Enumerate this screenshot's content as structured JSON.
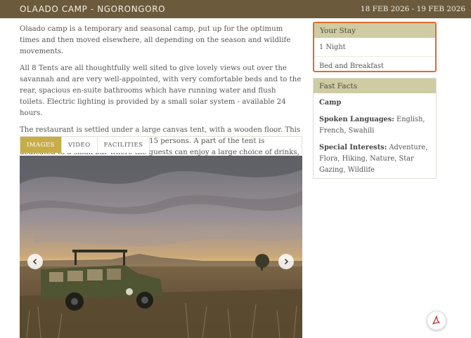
{
  "header": {
    "title": "OLAADO CAMP - NGORONGORO",
    "dates": "18 FEB 2026 - 19 FEB 2026"
  },
  "description": {
    "paragraphs": [
      "Olaado camp is a temporary and seasonal camp, put up for the optimum times and then moved elsewhere, all depending on the season and wildlife movements.",
      "All 8 Tents are all thoughtfully well sited to give lovely views out over the savannah and are very well-appointed, with very comfortable beds and to the rear, spacious en-suite bathrooms which have running water and flush toilets. Electric lighting is provided by a small solar system - available 24 hours.",
      "The restaurant is settled under a large canvas tent, with a wooden floor. This restaurant can accommodate up to 15 persons. A part of the tent is dedicated to a small bar where the guests can enjoy a large choice of drinks, before or after dinner."
    ]
  },
  "media_tabs": {
    "items": [
      "IMAGES",
      "VIDEO",
      "FACILITIES"
    ],
    "active_index": 0
  },
  "gallery": {
    "prev_icon": "chevron-left-icon",
    "next_icon": "chevron-right-icon"
  },
  "your_stay": {
    "heading": "Your Stay",
    "nights": "1 Night",
    "board": "Bed and Breakfast"
  },
  "fast_facts": {
    "heading": "Fast Facts",
    "type": "Camp",
    "languages_label": "Spoken Languages:",
    "languages_value": "English, French, Swahili",
    "interests_label": "Special Interests:",
    "interests_value": "Adventure, Flora, Hiking, Nature, Star Gazing, Wildlife"
  },
  "pdf_button": {
    "icon": "pdf-icon"
  },
  "colors": {
    "header_bg": "#6b5a3b",
    "tab_active": "#c6ad48",
    "panel_head": "#cfcca4",
    "highlight_border": "#e06b2e"
  }
}
